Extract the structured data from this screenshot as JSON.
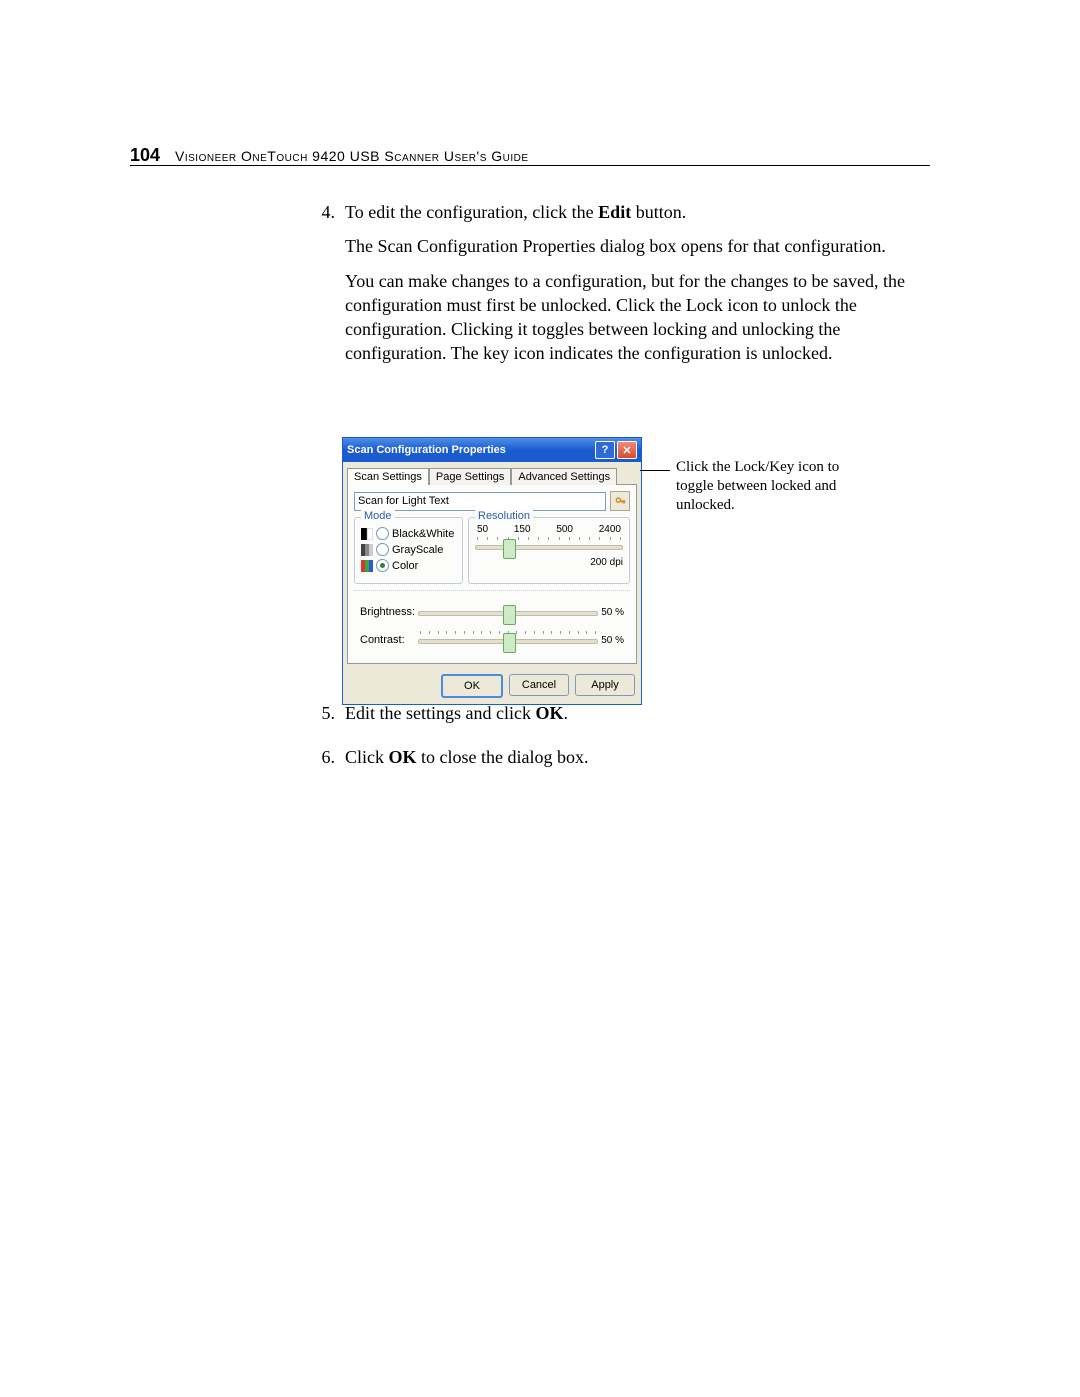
{
  "page": {
    "number": "104",
    "header": "Visioneer OneTouch 9420 USB Scanner User's Guide"
  },
  "steps": {
    "s4_num": "4.",
    "s4_p1a": "To edit the configuration, click the ",
    "s4_p1b": "Edit",
    "s4_p1c": " button.",
    "s4_p2": "The Scan Configuration Properties dialog box opens for that configuration.",
    "s4_p3": "You can make changes to a configuration, but for the changes to be saved, the configuration must first be unlocked. Click the Lock icon to unlock the configuration. Clicking it toggles between locking and unlocking the configuration. The key icon indicates the configuration is unlocked.",
    "s5_num": "5.",
    "s5a": "Edit the settings and click ",
    "s5b": "OK",
    "s5c": ".",
    "s6_num": "6.",
    "s6a": "Click ",
    "s6b": "OK",
    "s6c": " to close the dialog box."
  },
  "dialog": {
    "title": "Scan Configuration Properties",
    "tabs": {
      "t1": "Scan Settings",
      "t2": "Page Settings",
      "t3": "Advanced Settings"
    },
    "name_value": "Scan for Light Text",
    "mode": {
      "legend": "Mode",
      "bw": "Black&White",
      "gs": "GrayScale",
      "color": "Color"
    },
    "resolution": {
      "legend": "Resolution",
      "ticks": {
        "a": "50",
        "b": "150",
        "c": "500",
        "d": "2400"
      },
      "dpi": "200 dpi"
    },
    "brightness_label": "Brightness:",
    "brightness_val": "50 %",
    "contrast_label": "Contrast:",
    "contrast_val": "50 %",
    "ok": "OK",
    "cancel": "Cancel",
    "apply": "Apply"
  },
  "callout": "Click the Lock/Key icon to toggle between locked and unlocked."
}
